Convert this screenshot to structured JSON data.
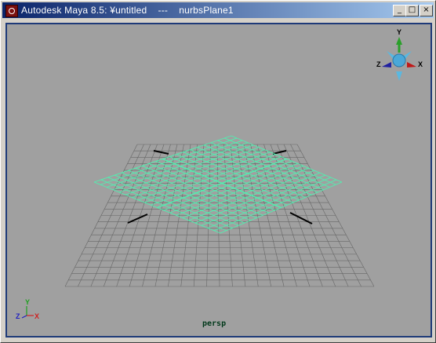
{
  "window": {
    "title": "Autodesk Maya 8.5: ¥untitled    ---    nurbsPlane1",
    "minimize_glyph": "_",
    "maximize_glyph": "□",
    "close_glyph": "×"
  },
  "viewport": {
    "camera_label": "persp",
    "background_color": "#a0a0a0",
    "frame_color": "#1e3a78",
    "grid_color": "#666666",
    "nurbs_color": "#50f0b0"
  },
  "view_cube": {
    "x": "X",
    "y": "Y",
    "z": "Z"
  },
  "axis_gizmo": {
    "x": "X",
    "y": "Y",
    "z": "Z"
  }
}
